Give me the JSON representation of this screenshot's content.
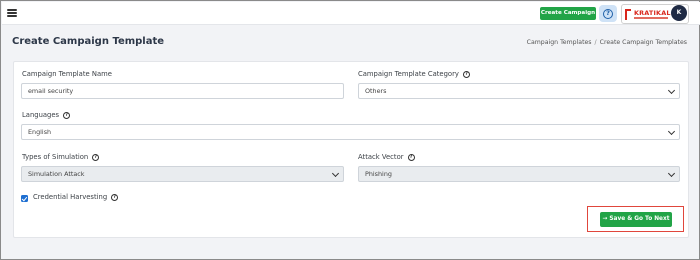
{
  "topbar": {
    "create_campaign_label": "Create Campaign",
    "brand_name": "KRATIKAL",
    "avatar_initial": "K",
    "accent": "#22a447"
  },
  "page": {
    "title": "Create Campaign Template",
    "breadcrumb": [
      "Campaign Templates",
      "Create Campaign Templates"
    ]
  },
  "form": {
    "template_name": {
      "label": "Campaign Template Name",
      "value": "email security"
    },
    "category": {
      "label": "Campaign Template Category",
      "value": "Others"
    },
    "languages": {
      "label": "Languages",
      "value": "English"
    },
    "simulation_type": {
      "label": "Types of Simulation",
      "value": "Simulation Attack"
    },
    "attack_vector": {
      "label": "Attack Vector",
      "value": "Phishing"
    },
    "credential_harvesting": {
      "label": "Credential Harvesting",
      "checked": true
    },
    "save_label": "Save & Go To Next"
  },
  "icons": [
    "menu-icon",
    "help-icon",
    "info-icon",
    "chevron-down-icon",
    "checkmark-icon",
    "arrow-right-icon"
  ]
}
